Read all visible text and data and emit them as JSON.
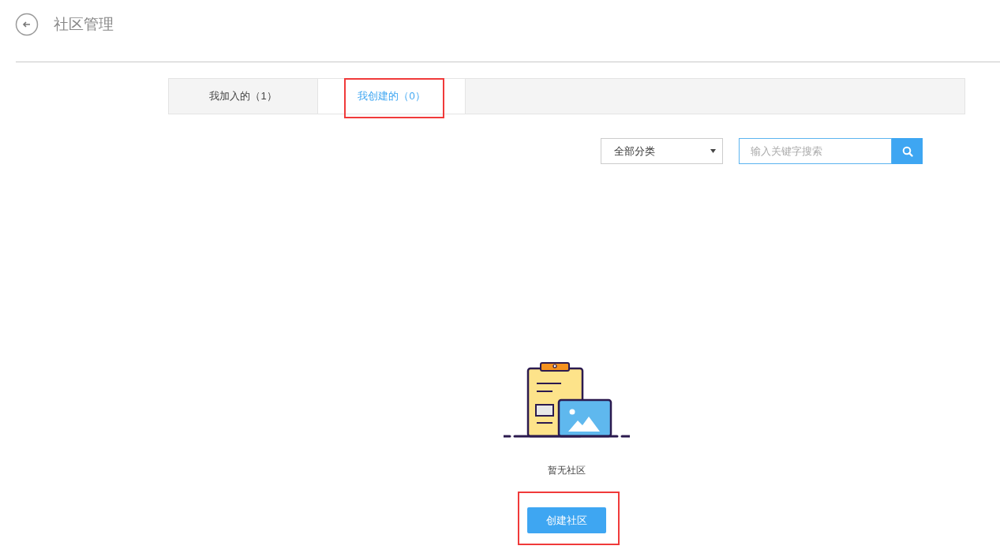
{
  "header": {
    "title": "社区管理"
  },
  "tabs": [
    {
      "label": "我加入的（1）",
      "selected": false,
      "highlighted": false
    },
    {
      "label": "我创建的（0）",
      "selected": true,
      "highlighted": true
    }
  ],
  "filters": {
    "category": "全部分类",
    "search": {
      "placeholder": "输入关键字搜索"
    }
  },
  "empty_state": {
    "message": "暂无社区",
    "button": {
      "label": "创建社区",
      "highlighted": true
    }
  }
}
